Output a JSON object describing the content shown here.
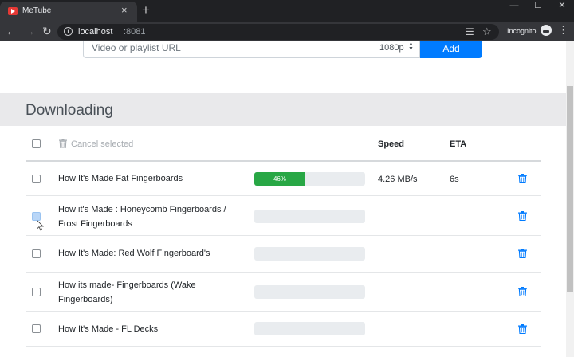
{
  "browser": {
    "tab_title": "MeTube",
    "tab_close": "×",
    "new_tab": "+",
    "window_controls": {
      "minimize": "—",
      "maximize": "☐",
      "close": "✕"
    },
    "nav": {
      "back": "←",
      "forward": "→",
      "reload": "↻"
    },
    "url_host": "localhost",
    "url_port": ":8081",
    "incognito_label": "Incognito",
    "menu": "⋮",
    "reader": "☰",
    "star": "☆",
    "info": "i"
  },
  "add_form": {
    "url_placeholder": "Video or playlist URL",
    "url_value": "",
    "quality": "1080p",
    "quality_arrows": "▲\n▼",
    "add_label": "Add"
  },
  "downloading": {
    "title": "Downloading",
    "cancel_selected": "Cancel selected",
    "col_speed": "Speed",
    "col_eta": "ETA",
    "rows": [
      {
        "title": "How It's Made Fat Fingerboards",
        "progress_percent": 46,
        "progress_label": "46%",
        "speed": "4.26 MB/s",
        "eta": "6s"
      },
      {
        "title": "How it's Made : Honeycomb Fingerboards / Frost Fingerboards",
        "progress_percent": 0,
        "progress_label": "",
        "speed": "",
        "eta": ""
      },
      {
        "title": "How It's Made: Red Wolf Fingerboard's",
        "progress_percent": 0,
        "progress_label": "",
        "speed": "",
        "eta": ""
      },
      {
        "title": "How its made- Fingerboards (Wake Fingerboards)",
        "progress_percent": 0,
        "progress_label": "",
        "speed": "",
        "eta": ""
      },
      {
        "title": "How It's Made - FL Decks",
        "progress_percent": 0,
        "progress_label": "",
        "speed": "",
        "eta": ""
      }
    ]
  },
  "colors": {
    "accent": "#007bff",
    "progress": "#28a745",
    "trash": "#007bff",
    "section_bg": "#e9e9eb"
  }
}
